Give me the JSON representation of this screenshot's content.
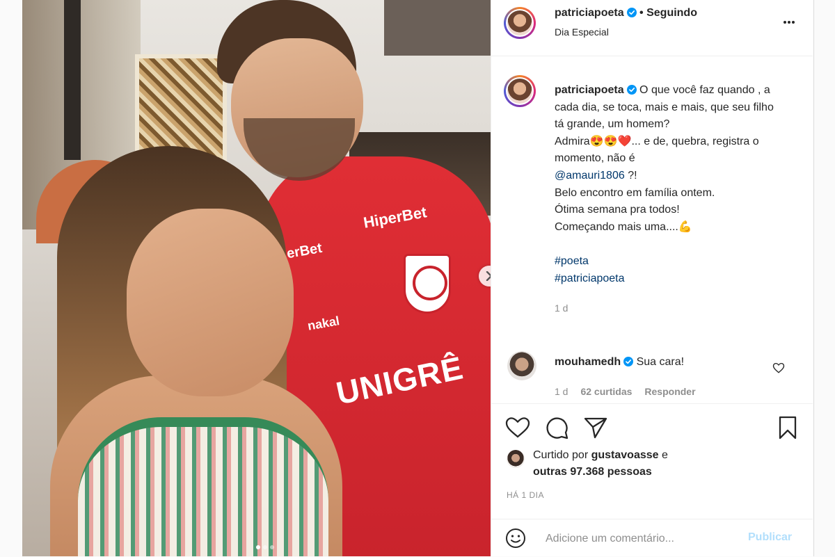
{
  "post": {
    "username": "patriciapoeta",
    "follow_status": "• Seguindo",
    "location": "Dia Especial",
    "more_icon": "more-horizontal-icon"
  },
  "caption": {
    "username": "patriciapoeta",
    "line1": "O que você faz quando , a cada dia, se toca, mais e mais, que seu filho tá grande, um homem?",
    "line2_prefix": "Admira",
    "line2_emojis": "😍😍❤️",
    "line2_suffix": "... e de, quebra, registra o momento, não é",
    "mention": "@amauri1806",
    "mention_suffix": " ?!",
    "line3": "Belo encontro em família ontem.",
    "line4": "Ótima semana pra todos!",
    "line5_prefix": "Começando mais uma....",
    "line5_emoji": "💪",
    "hashtag1": "#poeta",
    "hashtag2": "#patriciapoeta",
    "time": "1 d"
  },
  "comment": {
    "username": "mouhamedh",
    "text": "Sua cara!",
    "time": "1 d",
    "likes": "62 curtidas",
    "reply": "Responder"
  },
  "likes": {
    "prefix": "Curtido por",
    "user": "gustavoasse",
    "conj": "e",
    "others": "outras 97.368 pessoas"
  },
  "date": "HÁ 1 DIA",
  "add_comment": {
    "placeholder": "Adicione um comentário...",
    "publish": "Publicar"
  },
  "photo": {
    "shirt_sponsor": "HiperBet",
    "shirt_sponsor_partial": "erBet",
    "shirt_brand": "nakal",
    "shirt_main": "UNIGRÊ"
  },
  "colors": {
    "link": "#00376b",
    "verified": "#0095f6",
    "publish_disabled": "#b2dffc",
    "shirt_red": "#d9282f"
  },
  "carousel": {
    "slide_count_active": 1,
    "slides": 3
  }
}
